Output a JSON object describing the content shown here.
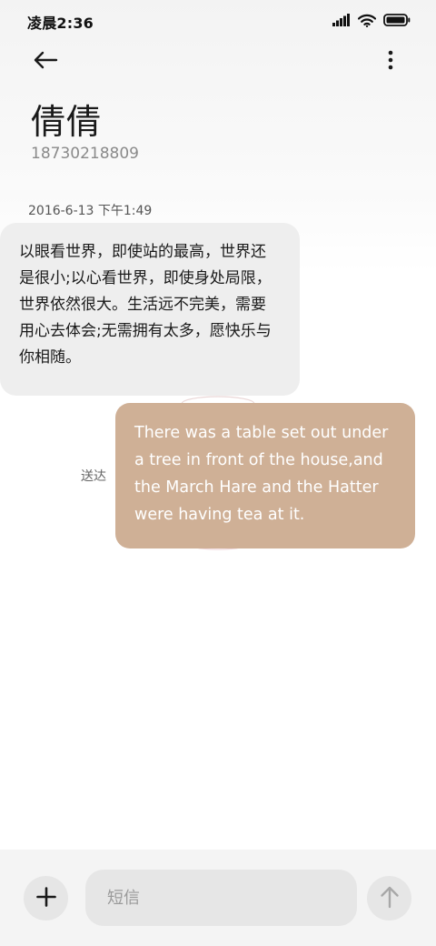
{
  "status_bar": {
    "time": "凌晨2:36",
    "icons": [
      "signal-icon",
      "wifi-icon",
      "battery-icon"
    ]
  },
  "header": {
    "back_icon": "arrow-left-icon",
    "more_icon": "more-vertical-icon",
    "contact_name": "倩倩",
    "contact_number": "18730218809"
  },
  "conversation": {
    "timestamp": "2016-6-13 下午1:49",
    "incoming_message": "以眼看世界，即使站的最高，世界还是很小;以心看世界，即使身处局限，世界依然很大。生活远不完美，需要用心去体会;无需拥有太多，愿快乐与你相随。",
    "outgoing_message": "There was a table set out under a tree in front of the house,and the March Hare and the Hatter were having tea at it.",
    "outgoing_status": "送达"
  },
  "composer": {
    "add_icon": "plus-icon",
    "placeholder": "短信",
    "value": "",
    "send_icon": "arrow-up-icon"
  },
  "colors": {
    "incoming_bubble": "#eeeeee",
    "outgoing_bubble": "#cfb096",
    "composer_bg": "#f4f4f4",
    "control_bg": "#e6e6e6"
  }
}
